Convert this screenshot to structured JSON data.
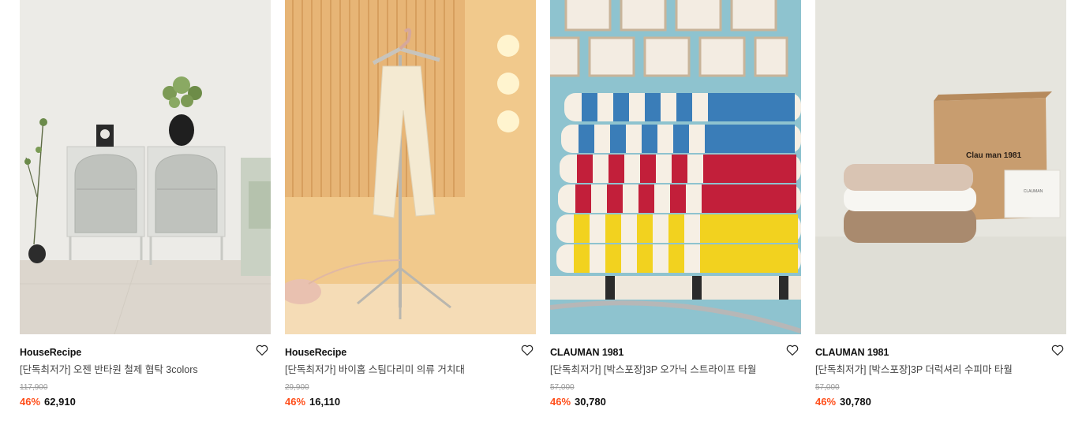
{
  "colors": {
    "discount": "#ff4e1a",
    "strike": "#999999"
  },
  "products": [
    {
      "brand": "HouseRecipe",
      "title": "[단독최저가] 오젠 반타원 철제 협탁 3colors",
      "original_price": "117,900",
      "discount": "46%",
      "price": "62,910",
      "image": "white-arched-cabinet-photo",
      "wishlist_icon": "heart-outline-icon"
    },
    {
      "brand": "HouseRecipe",
      "title": "[단독최저가] 바이홈 스팀다리미 의류 거치대",
      "original_price": "29,900",
      "discount": "46%",
      "price": "16,110",
      "image": "garment-steamer-stand-photo",
      "wishlist_icon": "heart-outline-icon"
    },
    {
      "brand": "CLAUMAN 1981",
      "title": "[단독최저가] [박스포장]3P 오가닉 스트라이프 타월",
      "original_price": "57,000",
      "discount": "46%",
      "price": "30,780",
      "image": "striped-towels-photo",
      "wishlist_icon": "heart-outline-icon"
    },
    {
      "brand": "CLAUMAN 1981",
      "title": "[단독최저가] [박스포장]3P 더럭셔리 수피마 타월",
      "original_price": "57,000",
      "discount": "46%",
      "price": "30,780",
      "image": "towel-gift-box-photo",
      "wishlist_icon": "heart-outline-icon",
      "box_logo": "Clau man 1981",
      "card_text": "CLAUMAN"
    }
  ]
}
